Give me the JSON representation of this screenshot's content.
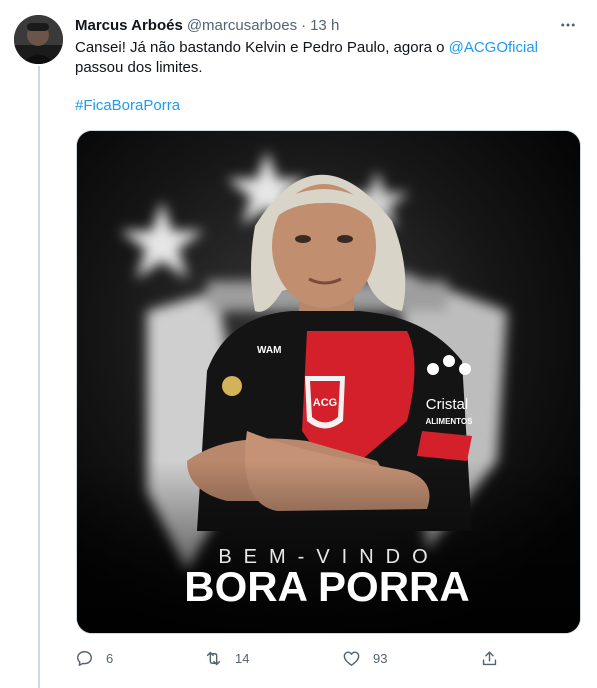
{
  "tweet": {
    "author_name": "Marcus Arboés",
    "author_handle": "@marcusarboes",
    "separator": "·",
    "time": "13 h",
    "text_before_mention": "Cansei! Já não bastando Kelvin e Pedro Paulo, agora o ",
    "mention": "@ACGOficial",
    "text_after_mention": " passou dos limites.",
    "hashtag": "#FicaBoraPorra",
    "image": {
      "headline_small": "BEM-VINDO",
      "headline_big": "BORA PORRA",
      "jersey_crest": "ACG",
      "jersey_sponsor_line1": "Cristal",
      "jersey_sponsor_line2": "ALIMENTOS",
      "jersey_brand": "WAM"
    },
    "stats": {
      "replies": "6",
      "retweets": "14",
      "likes": "93"
    }
  },
  "icons": {
    "more": "more-icon",
    "reply": "reply-icon",
    "retweet": "retweet-icon",
    "like": "heart-icon",
    "share": "share-icon"
  },
  "colors": {
    "link": "#1d9bf0",
    "muted": "#536471",
    "jersey_red": "#d3202a",
    "jersey_black": "#141414"
  }
}
